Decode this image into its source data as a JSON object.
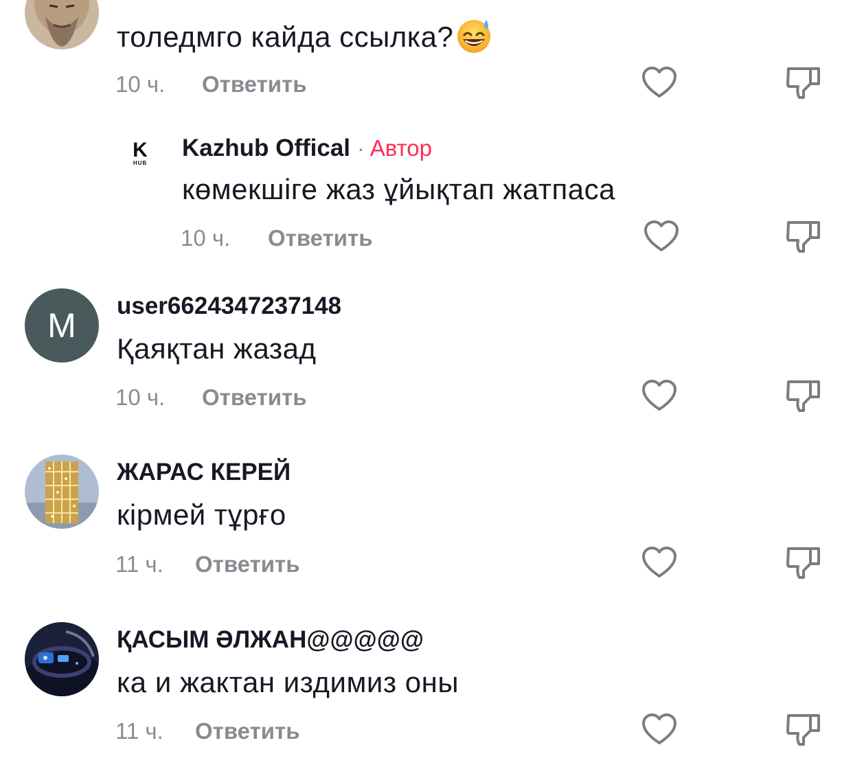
{
  "comments": [
    {
      "username": "",
      "text": "толедмго кайда ссылка?",
      "emoji": "sweat-smile-emoji",
      "time": "10 ч.",
      "reply_label": "Ответить"
    },
    {
      "username": "Kazhub Offical",
      "author_badge": "Автор",
      "dot": "·",
      "avatar_logo_main": "K",
      "avatar_logo_sub": "HUB",
      "text": "көмекшіге жаз ұйықтап жатпаса",
      "time": "10 ч.",
      "reply_label": "Ответить"
    },
    {
      "username": "user6624347237148",
      "avatar_letter": "M",
      "text": "Қаяқтан жазад",
      "time": "10 ч.",
      "reply_label": "Ответить"
    },
    {
      "username": "ЖАРАС КЕРЕЙ",
      "text": "кірмей тұрғо",
      "time": "11 ч.",
      "reply_label": "Ответить"
    },
    {
      "username": "ҚАСЫМ ӘЛЖАН@@@@@",
      "text": "ка и жактан издимиз оны",
      "time": "11 ч.",
      "reply_label": "Ответить"
    }
  ],
  "icons": {
    "like": "heart-outline-icon",
    "dislike": "thumbs-down-outline-icon"
  },
  "colors": {
    "author_badge": "#fe2c55",
    "meta_text": "#8a8b91",
    "primary_text": "#161823",
    "icon_stroke": "#7b7c82",
    "avatar_letter_bg": "#4a5a5c"
  }
}
